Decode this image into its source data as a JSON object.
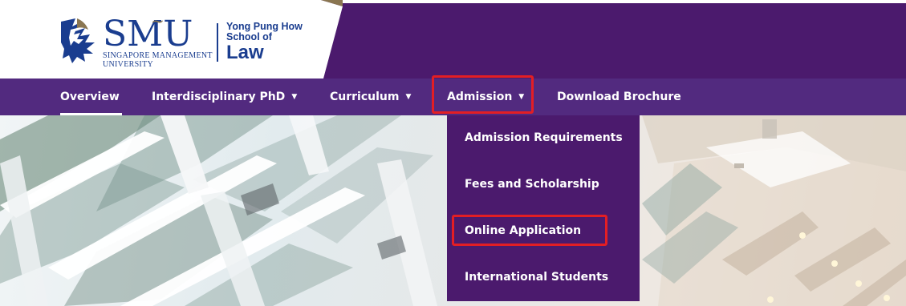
{
  "brand": {
    "logo_text": "SMU",
    "logo_subtitle_1": "SINGAPORE MANAGEMENT",
    "logo_subtitle_2": "UNIVERSITY",
    "school_line_1": "Yong Pung How",
    "school_line_2": "School of",
    "school_name": "Law",
    "colors": {
      "header_purple": "#4b1a6d",
      "nav_purple": "#522a7f",
      "logo_blue": "#1a3d8f",
      "gold": "#8a7651",
      "highlight_red": "#e31e24"
    }
  },
  "nav": {
    "items": [
      {
        "label": "Overview",
        "has_caret": false,
        "active": true
      },
      {
        "label": "Interdisciplinary PhD",
        "has_caret": true
      },
      {
        "label": "Curriculum",
        "has_caret": true
      },
      {
        "label": "Admission",
        "has_caret": true,
        "open": true
      },
      {
        "label": "Download Brochure",
        "has_caret": false
      }
    ],
    "caret_icon": "▼"
  },
  "admission_menu": {
    "items": [
      {
        "label": "Admission Requirements"
      },
      {
        "label": "Fees and Scholarship"
      },
      {
        "label": "Online Application"
      },
      {
        "label": "International Students"
      }
    ]
  }
}
